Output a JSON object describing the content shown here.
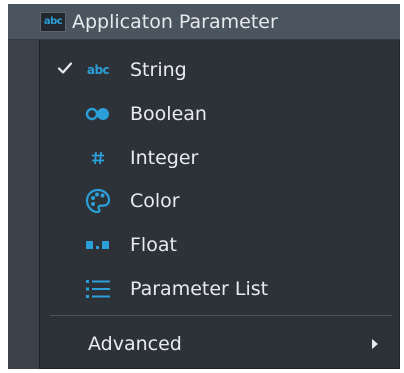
{
  "header": {
    "icon_text": "abc",
    "title": "Applicaton Parameter"
  },
  "menu": {
    "items": [
      {
        "label": "String",
        "icon": "abc-text-icon",
        "checked": true
      },
      {
        "label": "Boolean",
        "icon": "boolean-toggle-icon",
        "checked": false
      },
      {
        "label": "Integer",
        "icon": "hash-icon",
        "checked": false
      },
      {
        "label": "Color",
        "icon": "palette-icon",
        "checked": false
      },
      {
        "label": "Float",
        "icon": "float-icon",
        "checked": false
      },
      {
        "label": "Parameter List",
        "icon": "list-icon",
        "checked": false
      }
    ],
    "string_icon_text": "abc",
    "integer_icon_text": "#",
    "advanced": {
      "label": "Advanced"
    }
  },
  "colors": {
    "accent": "#2a9fd8",
    "menu_background": "#2d3238",
    "header_background": "#4b5560",
    "text": "#e8ebee"
  }
}
